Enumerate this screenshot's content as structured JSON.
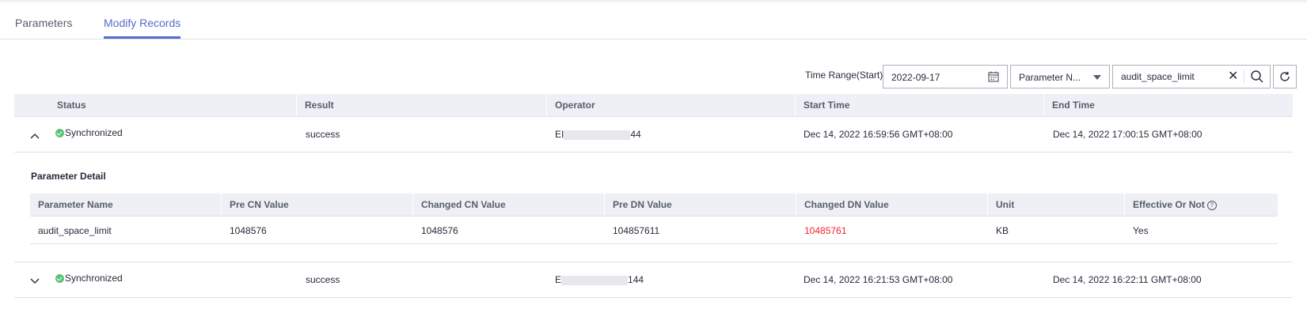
{
  "tabs": [
    {
      "label": "Parameters"
    },
    {
      "label": "Modify Records"
    }
  ],
  "filters": {
    "time_range_label": "Time Range(Start)",
    "date_value": "2022-09-17",
    "select_value": "Parameter N...",
    "search_value": "audit_space_limit"
  },
  "table": {
    "headers": [
      "Status",
      "Result",
      "Operator",
      "Start Time",
      "End Time"
    ],
    "rows": [
      {
        "status": "Synchronized",
        "result": "success",
        "operator_prefix": "EI",
        "operator_suffix": "44",
        "start_time": "Dec 14, 2022 16:59:56 GMT+08:00",
        "end_time": "Dec 14, 2022 17:00:15 GMT+08:00"
      },
      {
        "status": "Synchronized",
        "result": "success",
        "operator_prefix": "E",
        "operator_suffix": "144",
        "start_time": "Dec 14, 2022 16:21:53 GMT+08:00",
        "end_time": "Dec 14, 2022 16:22:11 GMT+08:00"
      }
    ]
  },
  "detail": {
    "title": "Parameter Detail",
    "headers": [
      "Parameter Name",
      "Pre CN Value",
      "Changed CN Value",
      "Pre DN Value",
      "Changed DN Value",
      "Unit",
      "Effective Or Not"
    ],
    "help_glyph": "?",
    "row": {
      "name": "audit_space_limit",
      "pre_cn": "1048576",
      "changed_cn": "1048576",
      "pre_dn": "104857611",
      "changed_dn": "10485761",
      "unit": "KB",
      "effective": "Yes"
    }
  },
  "colors": {
    "accent": "#526ecc",
    "success": "#5ac37a",
    "changed_value": "#f5222d",
    "header_bg": "#eef0f5"
  }
}
